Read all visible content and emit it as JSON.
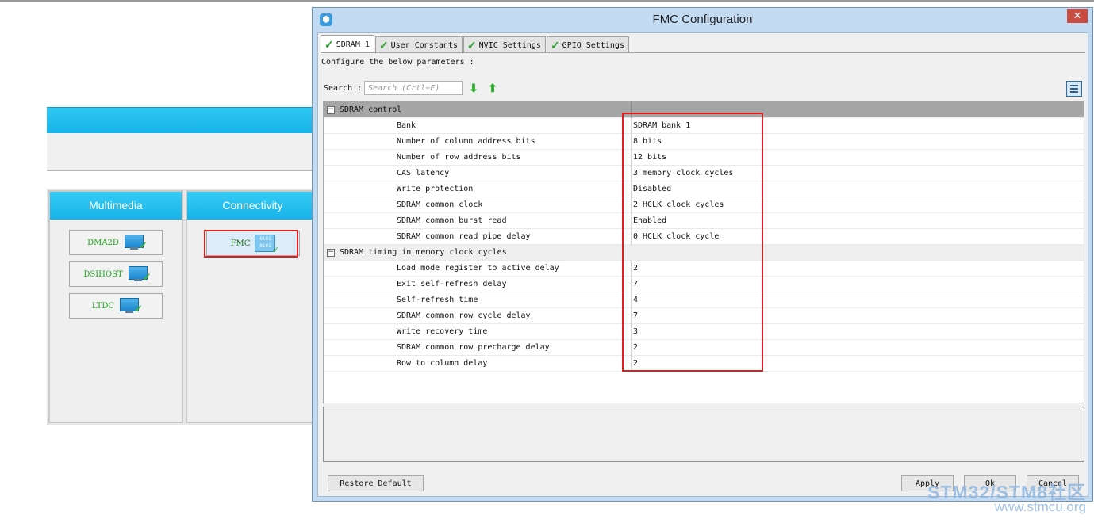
{
  "background": {
    "categories": [
      {
        "name": "Multimedia",
        "peripherals": [
          {
            "label": "DMA2D",
            "icon": "monitor-icon"
          },
          {
            "label": "DSIHOST",
            "icon": "monitor-icon"
          },
          {
            "label": "LTDC",
            "icon": "monitor-icon"
          }
        ]
      },
      {
        "name": "Connectivity",
        "peripherals": [
          {
            "label": "FMC",
            "icon": "chip-icon",
            "chip_text": "0101 0101"
          }
        ]
      }
    ]
  },
  "dialog": {
    "title": "FMC Configuration",
    "close_label": "✕",
    "tabs": [
      {
        "label": "SDRAM 1",
        "active": true
      },
      {
        "label": "User Constants",
        "active": false
      },
      {
        "label": "NVIC Settings",
        "active": false
      },
      {
        "label": "GPIO Settings",
        "active": false
      }
    ],
    "configure_text": "Configure the below parameters :",
    "search": {
      "label": "Search :",
      "placeholder": "Search (Crtl+F)",
      "value": ""
    },
    "groups": [
      {
        "name": "SDRAM control",
        "expander": "−",
        "params": [
          {
            "name": "Bank",
            "value": "SDRAM bank 1"
          },
          {
            "name": "Number of column address bits",
            "value": "8 bits"
          },
          {
            "name": "Number of row address bits",
            "value": "12 bits"
          },
          {
            "name": "CAS latency",
            "value": "3 memory clock cycles"
          },
          {
            "name": "Write protection",
            "value": "Disabled"
          },
          {
            "name": "SDRAM common clock",
            "value": "2 HCLK clock cycles"
          },
          {
            "name": "SDRAM common burst read",
            "value": "Enabled"
          },
          {
            "name": "SDRAM common read pipe delay",
            "value": "0 HCLK clock cycle"
          }
        ]
      },
      {
        "name": "SDRAM timing in memory clock cycles",
        "expander": "−",
        "params": [
          {
            "name": "Load mode register to active delay",
            "value": "2"
          },
          {
            "name": "Exit self-refresh delay",
            "value": "7"
          },
          {
            "name": "Self-refresh time",
            "value": "4"
          },
          {
            "name": "SDRAM common row cycle delay",
            "value": "7"
          },
          {
            "name": "Write recovery time",
            "value": "3"
          },
          {
            "name": "SDRAM common row precharge delay",
            "value": "2"
          },
          {
            "name": "Row to column delay",
            "value": "2"
          }
        ]
      }
    ],
    "buttons": {
      "restore_default": "Restore Default",
      "apply": "Apply",
      "ok": "Ok",
      "cancel": "Cancel"
    }
  },
  "watermark": {
    "line1": "STM32/STM8社区",
    "line2": "www.stmcu.org"
  },
  "colors": {
    "highlight": "#e01e1e",
    "category_header": "#16b3e7",
    "check": "#2ea52e"
  }
}
